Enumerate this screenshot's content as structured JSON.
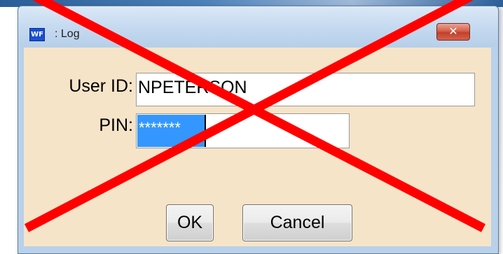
{
  "window": {
    "icon_text": "WF",
    "title": ": Log",
    "close_glyph": "✕"
  },
  "form": {
    "user_id_label": "User ID:",
    "user_id_value": "NPETERSON",
    "pin_label": "PIN:",
    "pin_value": "*******"
  },
  "buttons": {
    "ok_label": "OK",
    "cancel_label": "Cancel"
  },
  "overlay": {
    "mark": "red-x-strike",
    "color": "#ff0000"
  },
  "colors": {
    "dialog_background": "#f6e4c9",
    "title_bar": "#c6daf0",
    "selection_highlight": "#3397ff",
    "close_button": "#c2402a"
  }
}
